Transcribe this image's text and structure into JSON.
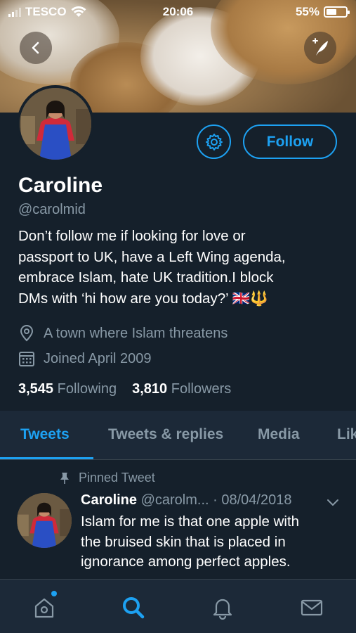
{
  "status_bar": {
    "carrier": "TESCO",
    "time": "20:06",
    "battery_percent": "55%",
    "battery_level": 0.55
  },
  "header": {
    "back_icon": "chevron-left-icon",
    "compose_icon": "compose-tweet-icon"
  },
  "profile": {
    "name": "Caroline",
    "handle": "@carolmid",
    "bio_lines": [
      "Don’t follow me if looking for love or",
      "passport to UK, have a Left Wing agenda,",
      "embrace Islam, hate UK tradition.I block",
      "DMs with ‘hi how are you today?’ 🇬🇧🔱"
    ],
    "location": "A town where Islam threatens",
    "joined": "Joined April 2009",
    "following_count": "3,545",
    "following_label": "Following",
    "followers_count": "3,810",
    "followers_label": "Followers",
    "follow_button": "Follow"
  },
  "tabs": [
    {
      "label": "Tweets",
      "active": true
    },
    {
      "label": "Tweets & replies",
      "active": false
    },
    {
      "label": "Media",
      "active": false
    },
    {
      "label": "Lik",
      "active": false
    }
  ],
  "pinned_tweet": {
    "pinned_label": "Pinned Tweet",
    "name": "Caroline",
    "handle_date": "@carolm... · 08/04/2018",
    "text_lines": [
      "Islam for me is that one apple with",
      "the bruised skin that is placed in",
      "ignorance among perfect apples."
    ]
  },
  "bottom_nav": [
    "home-icon",
    "search-icon",
    "notifications-icon",
    "messages-icon"
  ],
  "colors": {
    "background": "#15202b",
    "accent": "#1da1f2",
    "secondary_text": "#8899a6"
  }
}
